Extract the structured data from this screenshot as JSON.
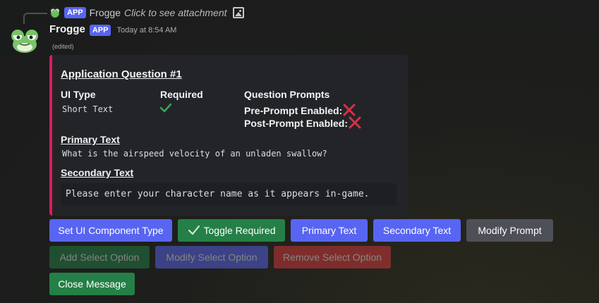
{
  "reply": {
    "tag": "APP",
    "name": "Frogge",
    "text": "Click to see attachment"
  },
  "message": {
    "username": "Frogge",
    "tag": "APP",
    "timestamp": "Today at 8:54 AM",
    "edited": "(edited)"
  },
  "embed": {
    "accent_color": "#e0195f",
    "title": "Application Question #1",
    "fields": {
      "ui_type": {
        "name": "UI Type",
        "value": "Short Text"
      },
      "required": {
        "name": "Required",
        "value_icon": "check-icon"
      },
      "question_prompts": {
        "name": "Question Prompts",
        "pre_prompt": "Pre-Prompt Enabled:",
        "post_prompt": "Post-Prompt Enabled:",
        "pre_icon": "x-icon",
        "post_icon": "x-icon"
      },
      "primary_text": {
        "name": "Primary Text",
        "value": "What is the airspeed velocity of an unladen swallow?"
      },
      "secondary_text": {
        "name": "Secondary Text",
        "value": "Please enter your character name as it appears in-game."
      }
    }
  },
  "buttons": {
    "row1": [
      {
        "label": "Set UI Component Type",
        "style": "blurple"
      },
      {
        "label": "Toggle Required",
        "style": "green",
        "icon": "check-icon"
      },
      {
        "label": "Primary Text",
        "style": "blurple"
      },
      {
        "label": "Secondary Text",
        "style": "blurple"
      },
      {
        "label": "Modify Prompt",
        "style": "grey"
      }
    ],
    "row2": [
      {
        "label": "Add Select Option",
        "style": "green",
        "disabled": true
      },
      {
        "label": "Modify Select Option",
        "style": "blurple",
        "disabled": true
      },
      {
        "label": "Remove Select Option",
        "style": "red",
        "disabled": true
      }
    ],
    "row3": [
      {
        "label": "Close Message",
        "style": "green"
      }
    ]
  },
  "colors": {
    "blurple": "#5865f2",
    "green": "#248046",
    "grey": "#4e5058",
    "red": "#da373c"
  }
}
